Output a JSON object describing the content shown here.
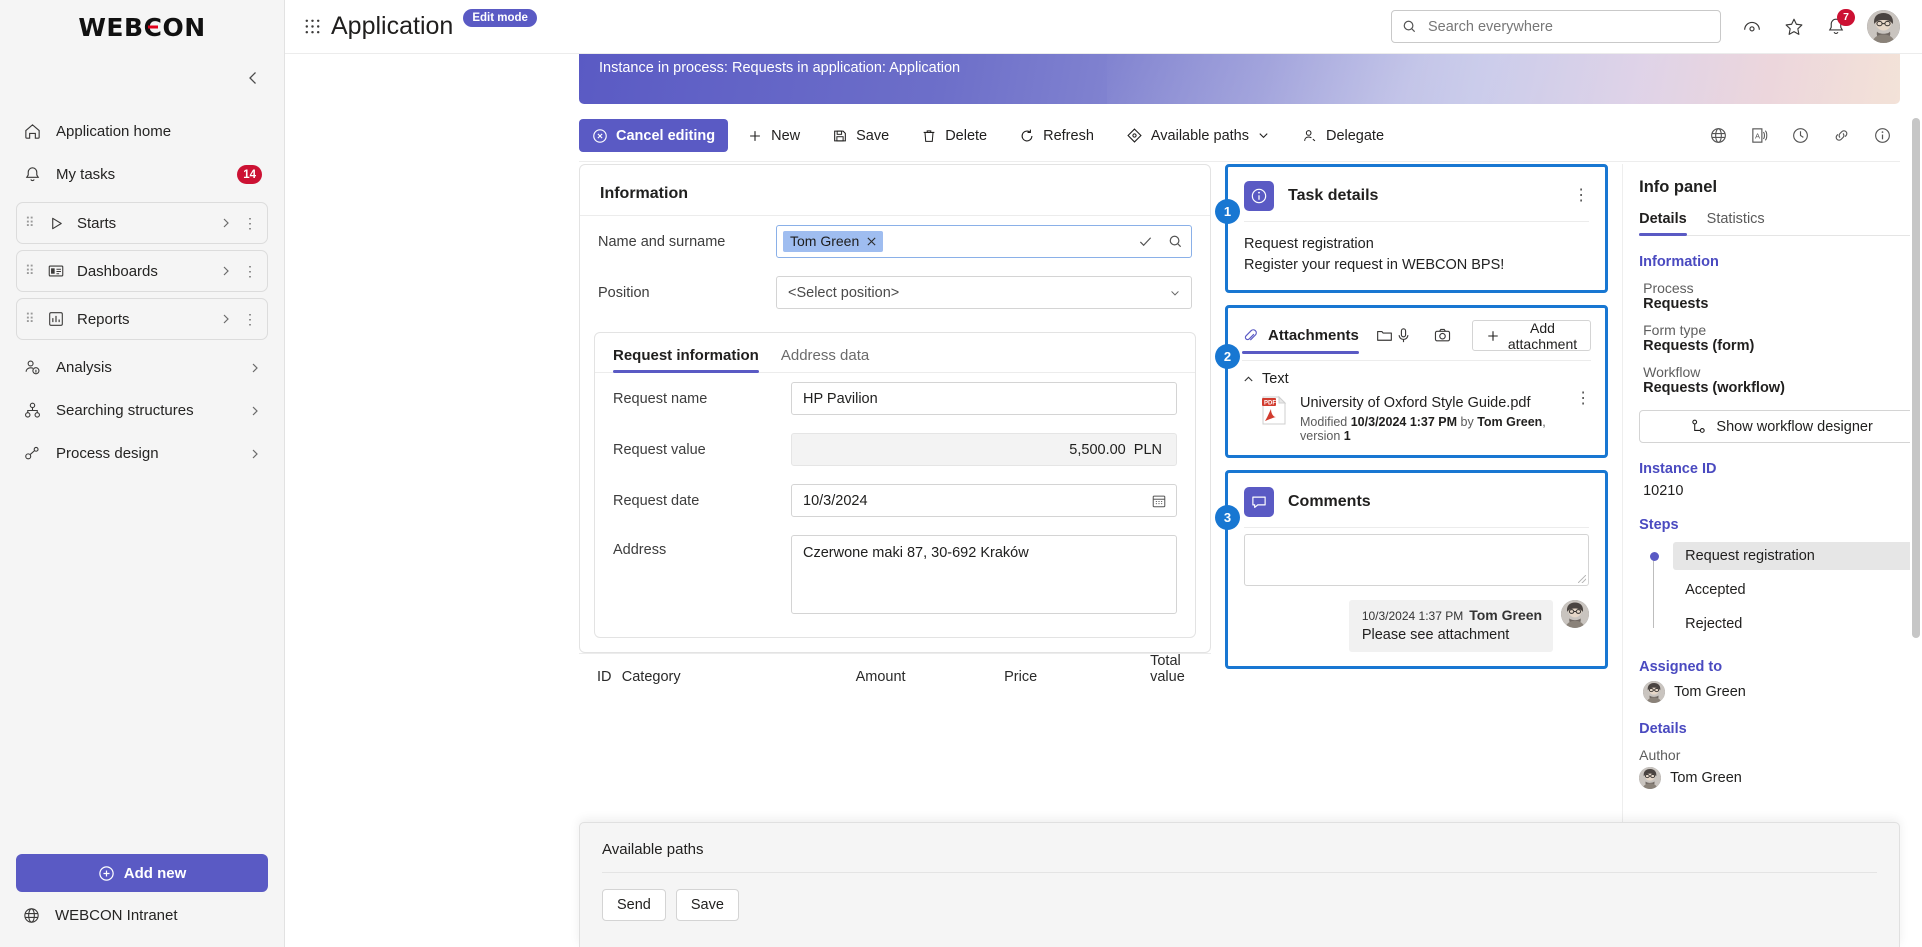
{
  "sidebar": {
    "logo": "WEBCON",
    "collapse_icon": "chevron-left-icon",
    "items": [
      {
        "label": "Application home",
        "icon": "home-icon",
        "badge": ""
      },
      {
        "label": "My tasks",
        "icon": "bell-icon",
        "badge": "14"
      }
    ],
    "cards": [
      {
        "label": "Starts",
        "icon": "play-icon"
      },
      {
        "label": "Dashboards",
        "icon": "dashboard-icon"
      },
      {
        "label": "Reports",
        "icon": "chart-icon"
      }
    ],
    "links": [
      {
        "label": "Analysis",
        "icon": "analysis-icon"
      },
      {
        "label": "Searching structures",
        "icon": "structures-icon"
      },
      {
        "label": "Process design",
        "icon": "process-design-icon"
      }
    ],
    "add_new": "Add new",
    "intranet": "WEBCON Intranet"
  },
  "topbar": {
    "waffle_icon": "grid-icon",
    "title": "Application",
    "edit_mode": "Edit mode",
    "search_placeholder": "Search everywhere",
    "search_value": "",
    "icons": [
      "eye-icon",
      "star-icon",
      "bell-icon"
    ],
    "notification_count": "7"
  },
  "banner": {
    "text": "Instance in process: Requests in application: Application"
  },
  "actionbar": {
    "primary": {
      "label": "Cancel editing",
      "icon": "cancel-circle-icon"
    },
    "buttons": [
      {
        "label": "New",
        "icon": "plus-icon"
      },
      {
        "label": "Save",
        "icon": "save-icon"
      },
      {
        "label": "Delete",
        "icon": "trash-icon"
      },
      {
        "label": "Refresh",
        "icon": "refresh-icon"
      },
      {
        "label": "Available paths",
        "icon": "diamond-icon",
        "caret": true
      },
      {
        "label": "Delegate",
        "icon": "person-add-icon"
      }
    ],
    "right_icons": [
      "globe-icon",
      "translate-icon",
      "history-icon",
      "link-icon",
      "info-icon"
    ]
  },
  "information_card": {
    "title": "Information",
    "fields": [
      {
        "label": "Name and surname",
        "type": "people",
        "value": "Tom Green"
      },
      {
        "label": "Position",
        "type": "select",
        "value": "<Select position>"
      }
    ],
    "tabs": [
      {
        "label": "Request information",
        "active": true
      },
      {
        "label": "Address data",
        "active": false
      }
    ],
    "tab_fields": [
      {
        "label": "Request name",
        "type": "text",
        "value": "HP Pavilion"
      },
      {
        "label": "Request value",
        "type": "readonly",
        "value": "5,500.00  PLN"
      },
      {
        "label": "Request date",
        "type": "date",
        "value": "10/3/2024"
      },
      {
        "label": "Address",
        "type": "textarea",
        "value": "Czerwone maki 87, 30-692 Kraków"
      }
    ]
  },
  "item_table": {
    "columns": [
      "ID",
      "Category",
      "Amount",
      "Price",
      "Total value"
    ]
  },
  "task_details": {
    "badge": "1",
    "icon": "info-circle-icon",
    "title": "Task details",
    "step_name": "Request registration",
    "description": "Register your request in WEBCON BPS!"
  },
  "attachments": {
    "badge": "2",
    "tab_label": "Attachments",
    "folder_icon": "folder-icon",
    "mic_icon": "microphone-icon",
    "camera_icon": "camera-icon",
    "add_label": "Add attachment",
    "group": "Text",
    "files": [
      {
        "name": "University of Oxford Style Guide.pdf",
        "meta_prefix": "Modified ",
        "meta_date": "10/3/2024 1:37 PM",
        "meta_by": " by ",
        "meta_author": "Tom Green",
        "meta_version_label": ", version ",
        "meta_version": "1"
      }
    ]
  },
  "comments": {
    "badge": "3",
    "icon": "comment-icon",
    "title": "Comments",
    "input_value": "",
    "list": [
      {
        "timestamp": "10/3/2024 1:37 PM",
        "author": "Tom Green",
        "text": "Please see attachment"
      }
    ]
  },
  "info_panel": {
    "title": "Info panel",
    "tabs": [
      {
        "label": "Details",
        "active": true
      },
      {
        "label": "Statistics",
        "active": false
      }
    ],
    "information_header": "Information",
    "rows": [
      {
        "label": "Process",
        "value": "Requests"
      },
      {
        "label": "Form type",
        "value": "Requests (form)"
      },
      {
        "label": "Workflow",
        "value": "Requests (workflow)"
      }
    ],
    "designer_button": "Show workflow designer",
    "instance_id_header": "Instance ID",
    "instance_id": "10210",
    "steps_header": "Steps",
    "steps": [
      {
        "label": "Request registration",
        "active": true
      },
      {
        "label": "Accepted",
        "active": false
      },
      {
        "label": "Rejected",
        "active": false
      }
    ],
    "assigned_header": "Assigned to",
    "assigned_to": "Tom Green",
    "details_header": "Details",
    "author_label": "Author",
    "author": "Tom Green"
  },
  "sheet": {
    "title": "Available paths",
    "buttons": [
      {
        "label": "Send"
      },
      {
        "label": "Save"
      }
    ]
  },
  "colors": {
    "accent": "#5a5ac4",
    "highlight": "#1877d2",
    "badge_red": "#cc1133"
  }
}
